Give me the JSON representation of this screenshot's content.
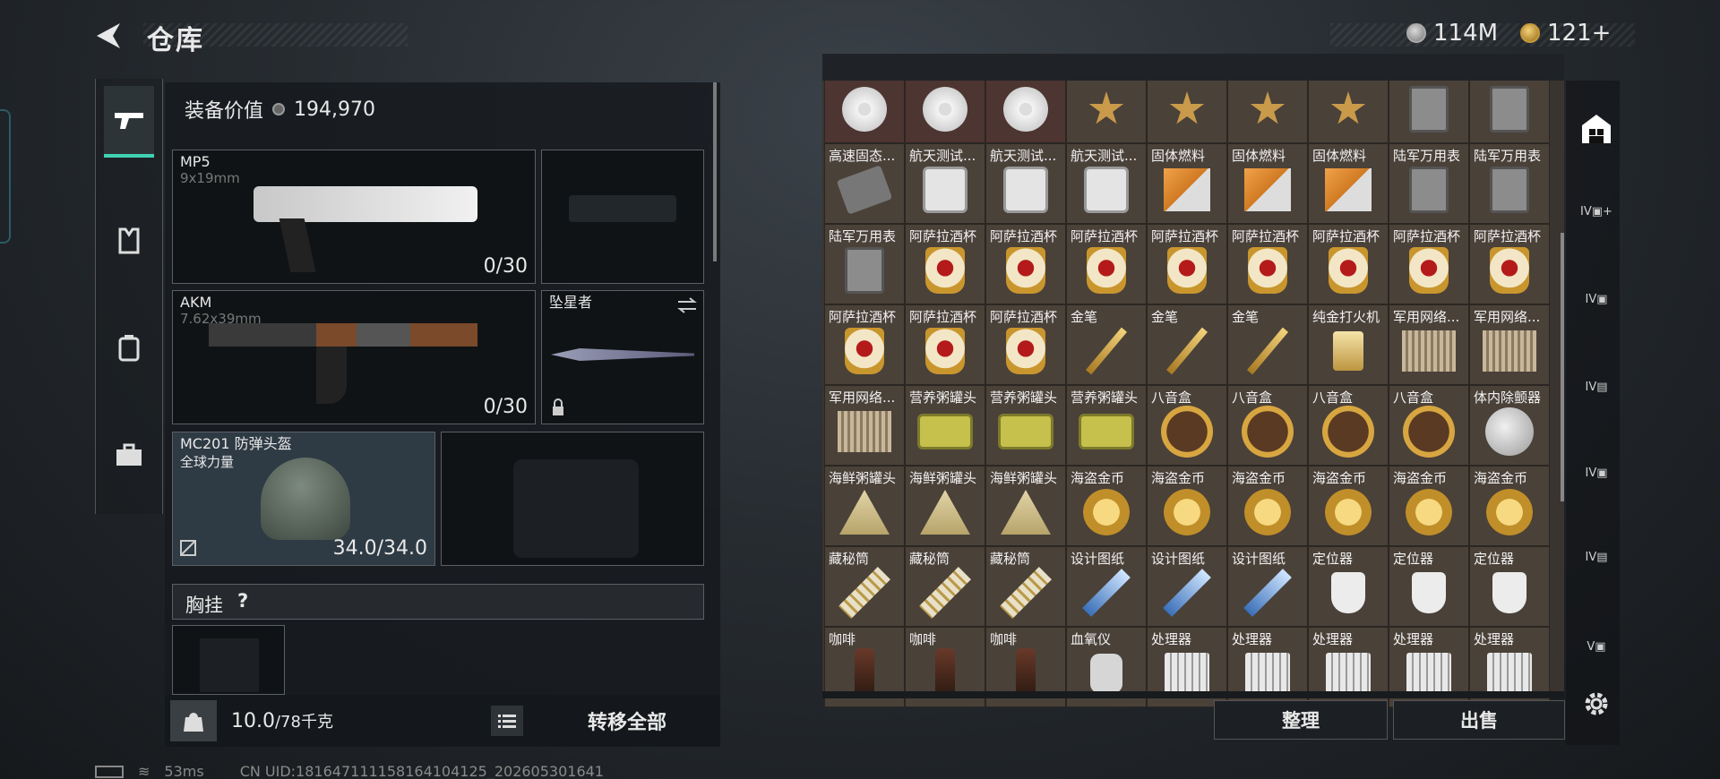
{
  "header": {
    "title": "仓库",
    "currency_silver": "114M",
    "currency_gold": "121+"
  },
  "loadout": {
    "value_label": "装备价值",
    "value": "194,970",
    "primary": {
      "name": "MP5",
      "caliber": "9x19mm",
      "ammo": "0/30"
    },
    "secondary": {
      "name": "AKM",
      "caliber": "7.62x39mm",
      "ammo": "0/30"
    },
    "melee": {
      "name": "坠星者"
    },
    "helmet": {
      "name": "MC201 防弹头盔",
      "sub": "全球力量",
      "durability": "34.0/34.0"
    },
    "chest_label": "胸挂",
    "help": "?",
    "weight": "10.0",
    "weight_cap": "/78千克",
    "transfer_all": "转移全部"
  },
  "inventory": {
    "rows": [
      [
        "",
        "",
        "",
        "",
        "",
        "",
        "",
        "",
        ""
      ],
      [
        "高速固态...",
        "航天测试...",
        "航天测试...",
        "航天测试...",
        "固体燃料",
        "固体燃料",
        "固体燃料",
        "陆军万用表",
        "陆军万用表"
      ],
      [
        "陆军万用表",
        "阿萨拉酒杯",
        "阿萨拉酒杯",
        "阿萨拉酒杯",
        "阿萨拉酒杯",
        "阿萨拉酒杯",
        "阿萨拉酒杯",
        "阿萨拉酒杯",
        "阿萨拉酒杯"
      ],
      [
        "阿萨拉酒杯",
        "阿萨拉酒杯",
        "阿萨拉酒杯",
        "金笔",
        "金笔",
        "金笔",
        "纯金打火机",
        "军用网络...",
        "军用网络..."
      ],
      [
        "军用网络...",
        "营养粥罐头",
        "营养粥罐头",
        "营养粥罐头",
        "八音盒",
        "八音盒",
        "八音盒",
        "八音盒",
        "体内除颤器"
      ],
      [
        "海鲜粥罐头",
        "海鲜粥罐头",
        "海鲜粥罐头",
        "海盗金币",
        "海盗金币",
        "海盗金币",
        "海盗金币",
        "海盗金币",
        "海盗金币"
      ],
      [
        "藏秘筒",
        "藏秘筒",
        "藏秘筒",
        "设计图纸",
        "设计图纸",
        "设计图纸",
        "定位器",
        "定位器",
        "定位器"
      ],
      [
        "咖啡",
        "咖啡",
        "咖啡",
        "血氧仪",
        "处理器",
        "处理器",
        "处理器",
        "处理器",
        "处理器"
      ]
    ],
    "icon_rows": [
      [
        "disc",
        "disc",
        "disc",
        "medal",
        "medal",
        "medal",
        "medal",
        "device",
        "device"
      ],
      [
        "ssd",
        "meter",
        "meter",
        "meter",
        "fuel",
        "fuel",
        "fuel",
        "device",
        "device"
      ],
      [
        "device",
        "cup",
        "cup",
        "cup",
        "cup",
        "cup",
        "cup",
        "cup",
        "cup"
      ],
      [
        "cup",
        "cup",
        "cup",
        "pen",
        "pen",
        "pen",
        "lighter",
        "crate",
        "crate"
      ],
      [
        "crate",
        "tin",
        "tin",
        "tin",
        "musicbox",
        "musicbox",
        "musicbox",
        "musicbox",
        "pod"
      ],
      [
        "tri",
        "tri",
        "tri",
        "coin",
        "coin",
        "coin",
        "coin",
        "coin",
        "coin"
      ],
      [
        "tube",
        "tube",
        "tube",
        "blueprint",
        "blueprint",
        "blueprint",
        "tag",
        "tag",
        "tag"
      ],
      [
        "bottle",
        "bottle",
        "bottle",
        "oxi",
        "cpu",
        "cpu",
        "cpu",
        "cpu",
        "cpu"
      ]
    ],
    "sort_label": "整理",
    "sell_label": "出售"
  },
  "right_nav": [
    "IV",
    "IV",
    "IV",
    "IV",
    "IV",
    "V"
  ],
  "status": {
    "ping": "53ms",
    "uid": "CN UID:18164711115816410412​5_202605301641"
  }
}
